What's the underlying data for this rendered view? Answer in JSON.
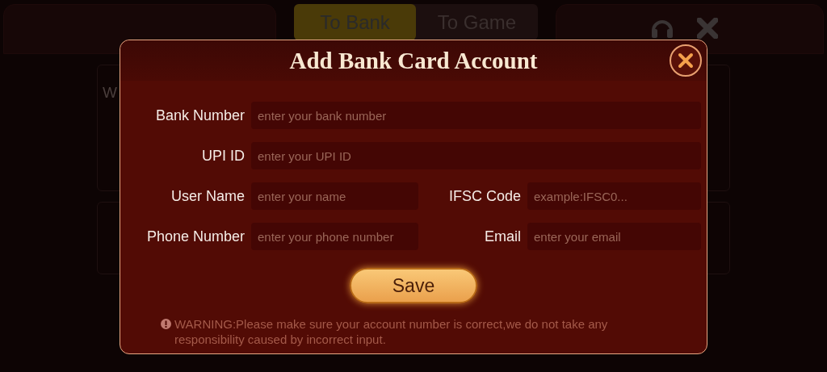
{
  "background": {
    "tabs": [
      {
        "label": "To Bank",
        "selected": true
      },
      {
        "label": "To Game",
        "selected": false
      }
    ],
    "card_text": "W"
  },
  "dialog": {
    "title": "Add Bank Card Account",
    "fields": [
      {
        "label": "Bank Number",
        "placeholder": "enter your bank number",
        "kind": "full"
      },
      {
        "label": "UPI ID",
        "placeholder": "enter your UPI ID",
        "kind": "full"
      },
      {
        "label": "User Name",
        "placeholder": "enter your name",
        "kind": "half"
      },
      {
        "label": "IFSC Code",
        "placeholder": "example:IFSC0...",
        "kind": "half"
      },
      {
        "label": "Phone Number",
        "placeholder": "enter your phone number",
        "kind": "half"
      },
      {
        "label": "Email",
        "placeholder": "enter your email",
        "kind": "half"
      }
    ],
    "save_button": "Save",
    "warning": "WARNING:Please make sure your account number is correct,we do not take any responsibility caused by incorrect input."
  }
}
